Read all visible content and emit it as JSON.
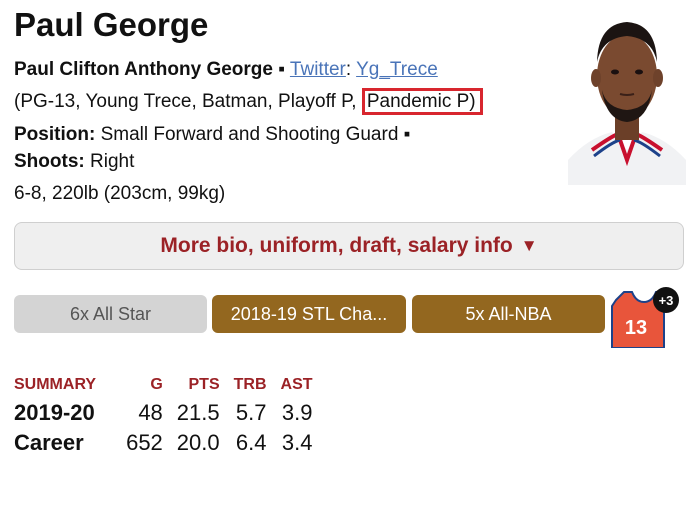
{
  "player": {
    "name": "Paul George",
    "full_name": "Paul Clifton Anthony George",
    "twitter_label": "Twitter",
    "twitter_handle": "Yg_Trece",
    "nicknames_open": "(PG-13, Young Trece, Batman, Playoff P, ",
    "nickname_highlighted": "Pandemic P)",
    "position_label": "Position:",
    "position_value": "Small Forward and Shooting Guard",
    "shoots_label": "Shoots:",
    "shoots_value": "Right",
    "size": "6-8, 220lb (203cm, 99kg)"
  },
  "more_button": {
    "label": "More bio, uniform, draft, salary info",
    "caret": "▼"
  },
  "badges": [
    "6x All Star",
    "2018-19 STL Cha...",
    "5x All-NBA"
  ],
  "jersey": {
    "number": "13",
    "extra": "+3"
  },
  "summary": {
    "headers": [
      "SUMMARY",
      "G",
      "PTS",
      "TRB",
      "AST"
    ],
    "rows": [
      [
        "2019-20",
        "48",
        "21.5",
        "5.7",
        "3.9"
      ],
      [
        "Career",
        "652",
        "20.0",
        "6.4",
        "3.4"
      ]
    ]
  },
  "colors": {
    "accent": "#9b2226",
    "link": "#4a74b8",
    "highlight": "#d8262e",
    "badge_gold": "#93671f",
    "badge_gray": "#d4d4d4"
  }
}
